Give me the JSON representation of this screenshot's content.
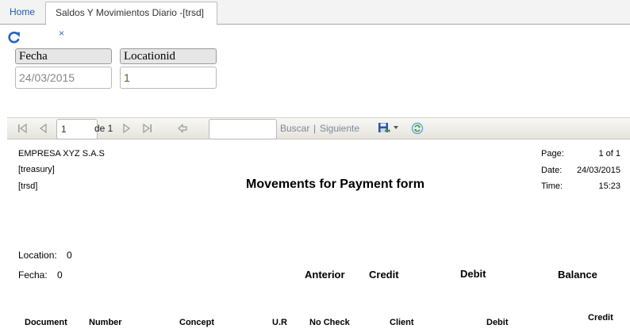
{
  "tabs": {
    "home": "Home",
    "active": "Saldos Y Movimientos Diario -[trsd]",
    "close_glyph": "×"
  },
  "params": {
    "fecha_label": "Fecha",
    "fecha_value": "24/03/2015",
    "location_label": "Locationid",
    "location_value": "1"
  },
  "toolbar": {
    "page_value": "1",
    "page_of": "de 1",
    "search_value": "",
    "find_label": "Buscar",
    "separator": "|",
    "next_label": "Siguiente"
  },
  "report": {
    "company": "EMPRESA XYZ S.A.S",
    "module": "[treasury]",
    "code": "[trsd]",
    "title": "Movements for Payment form",
    "page_label": "Page:",
    "page_value": "1 of 1",
    "date_label": "Date:",
    "date_value": "24/03/2015",
    "time_label": "Time:",
    "time_value": "15:23",
    "location_label": "Location:",
    "location_value": "0",
    "fecha_label": "Fecha:",
    "fecha_value": "0",
    "group_headers": {
      "anterior": "Anterior",
      "credit": "Credit",
      "debit": "Debit",
      "balance": "Balance"
    },
    "columns": {
      "document": "Document",
      "number": "Number",
      "concept": "Concept",
      "ur": "U.R",
      "no_check": "No Check",
      "client": "Client",
      "debit": "Debit",
      "credit": "Credit"
    }
  }
}
